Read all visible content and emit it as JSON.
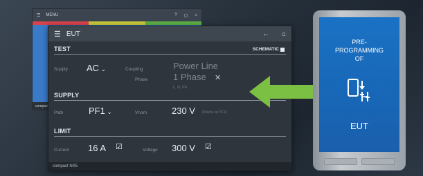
{
  "back_window": {
    "menu_label": "MENU",
    "footer": "compact"
  },
  "main_window": {
    "title": "EUT",
    "test": {
      "heading": "TEST",
      "schematic_label": "SCHEMATIC",
      "supply_label": "Supply",
      "supply_value": "AC",
      "coupling_label": "Coupling",
      "coupling_value": "Power Line",
      "phase_label": "Phase",
      "phase_value": "1 Phase",
      "phase_detail": "L, N, PE"
    },
    "supply": {
      "heading": "SUPPLY",
      "path_label": "Path",
      "path_value": "PF1",
      "vnom_label": "Vnom",
      "vnom_value": "230 V",
      "vnom_note": "(Mains at PF1)"
    },
    "limit": {
      "heading": "LIMIT",
      "current_label": "Current",
      "current_value": "16 A",
      "voltage_label": "Voltage",
      "voltage_value": "300 V"
    },
    "footer": "compact NX5"
  },
  "tablet": {
    "line1": "PRE-",
    "line2": "PROGRAMMING",
    "line3": "OF",
    "eut": "EUT"
  },
  "colors": {
    "arrow": "#7cc043",
    "tablet_screen": "#1a6fc0",
    "stripe_red": "#d9434d",
    "stripe_yellow": "#c9c93c",
    "stripe_green": "#5db046"
  }
}
